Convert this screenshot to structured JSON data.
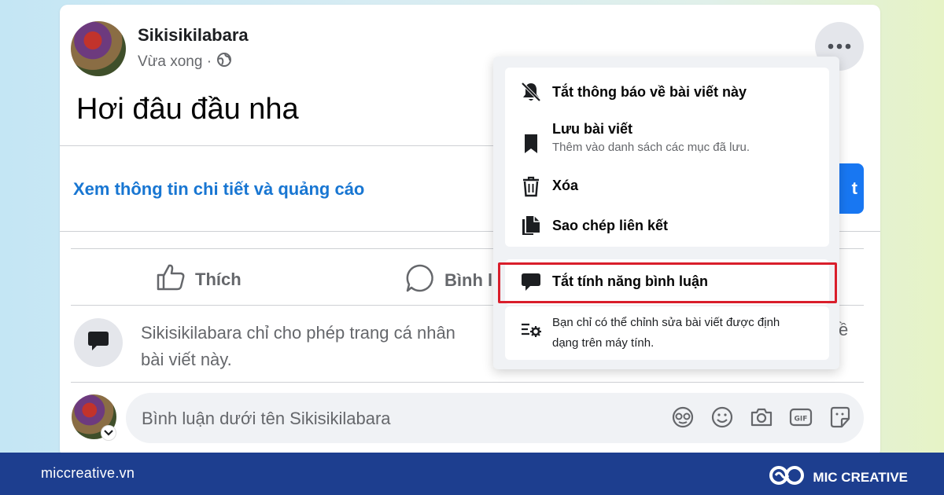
{
  "post": {
    "author": "Sikisikilabara",
    "time": "Vừa xong ·",
    "text": "Hơi đâu đầu nha",
    "details_link": "Xem thông tin chi tiết và quảng cáo",
    "cta_label": "t"
  },
  "actions": {
    "like": "Thích",
    "comment": "Bình l"
  },
  "restriction": {
    "line1": "Sikisikilabara chỉ cho phép trang cá nhân",
    "line2": "bài viết này.",
    "tail": "ề"
  },
  "comment_input": {
    "placeholder": "Bình luận dưới tên Sikisikilabara"
  },
  "menu": {
    "mute": "Tắt thông báo về bài viết này",
    "save": "Lưu bài viết",
    "save_sub": "Thêm vào danh sách các mục đã lưu.",
    "delete": "Xóa",
    "copy_link": "Sao chép liên kết",
    "disable_comments": "Tắt tính năng bình luận",
    "edit_note_line1": "Bạn chỉ có thể chỉnh sửa bài viết được định",
    "edit_note_line2": "dạng trên máy tính."
  },
  "footer": {
    "website": "miccreative.vn",
    "brand": "MIC CREATIVE"
  },
  "colors": {
    "link": "#1876d2",
    "highlight_border": "#d91e2b",
    "footer_bg": "#1d3e8f"
  }
}
